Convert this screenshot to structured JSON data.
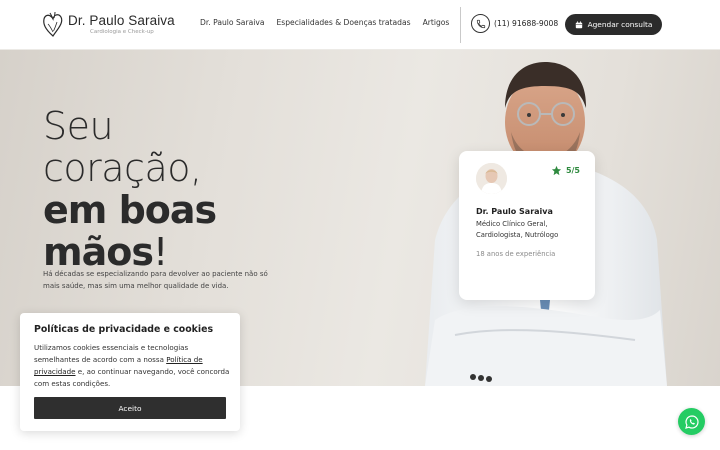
{
  "header": {
    "logo_name": "Dr. Paulo Saraiva",
    "logo_sub": "Cardiologia e Check-up",
    "nav": [
      "Dr. Paulo Saraiva",
      "Especialidades & Doenças tratadas",
      "Artigos"
    ],
    "phone": "(11) 91688-9008",
    "cta_label": "Agendar consulta"
  },
  "hero": {
    "title_line1": "Seu",
    "title_line2": "coração,",
    "title_line3": "em boas",
    "title_line4": "mãos",
    "title_bang": "!",
    "description": "Há décadas se especializando para devolver ao paciente não só mais saúde, mas sim uma melhor qualidade de vida."
  },
  "card": {
    "rating": "5/5",
    "name": "Dr. Paulo Saraiva",
    "specialties": "Médico Clínico Geral, Cardiologista, Nutrólogo",
    "experience": "18 anos de experiência"
  },
  "cookie": {
    "title": "Políticas de privacidade e cookies",
    "text_before": "Utilizamos cookies essenciais e tecnologias semelhantes de acordo com a nossa ",
    "link": "Política de privacidade",
    "text_after": " e, ao continuar navegando, você concorda com estas condições.",
    "accept": "Aceito"
  },
  "colors": {
    "dark": "#2b2b2b",
    "star": "#2f8a3f",
    "whatsapp": "#24cc63"
  }
}
